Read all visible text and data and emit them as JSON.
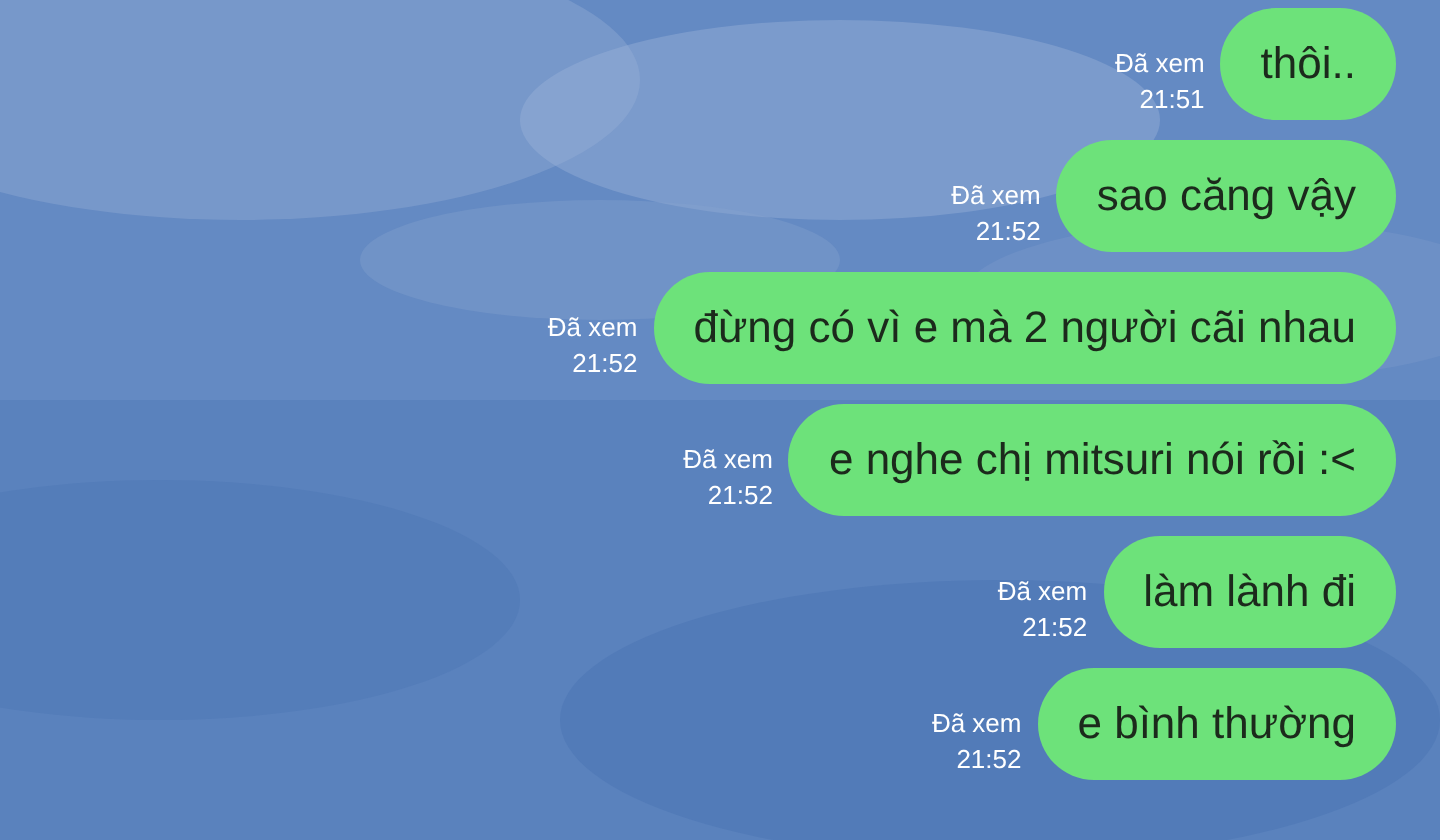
{
  "messages": [
    {
      "text": "thôi..",
      "status": "Đã xem",
      "time": "21:51"
    },
    {
      "text": "sao căng vậy",
      "status": "Đã xem",
      "time": "21:52"
    },
    {
      "text": "đừng có vì e mà 2 người cãi nhau",
      "status": "Đã xem",
      "time": "21:52"
    },
    {
      "text": "e nghe chị mitsuri nói rồi :<",
      "status": "Đã xem",
      "time": "21:52"
    },
    {
      "text": "làm lành đi",
      "status": "Đã xem",
      "time": "21:52"
    },
    {
      "text": "e bình thường",
      "status": "Đã xem",
      "time": "21:52"
    }
  ]
}
